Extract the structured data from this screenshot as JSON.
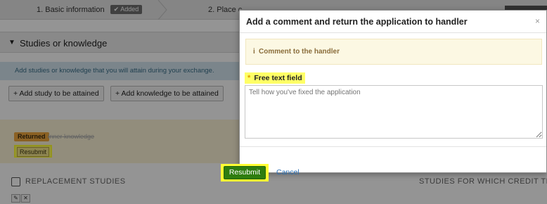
{
  "steps": {
    "step1_label": "1. Basic information",
    "step1_badge": "Added",
    "step2_label": "2. Place c"
  },
  "section": {
    "title": "Studies or knowledge",
    "info": "Add studies or knowledge that you will attain during your exchange.",
    "add_study_label": "Add study to be attained",
    "add_knowledge_label": "Add knowledge to be attained"
  },
  "returned": {
    "badge": "Returned",
    "text": "Inner knowledge",
    "resubmit_label": "Resubmit"
  },
  "replacement": {
    "title": "REPLACEMENT STUDIES",
    "credit_title": "STUDIES FOR WHICH CREDIT TRA"
  },
  "dialog": {
    "title": "Add a comment and return the application to handler",
    "close_symbol": "×",
    "comment_icon": "i",
    "comment_label": "Comment to the handler",
    "required_mark": "*",
    "field_label": "Free text field",
    "textarea_placeholder": "Tell how you've fixed the application",
    "resubmit_label": "Resubmit",
    "cancel_label": "Cancel"
  },
  "colors": {
    "primary_button": "#2e7d0f",
    "highlight": "#ffff33",
    "link": "#2b6fb3",
    "warning_bg": "#fcf8e3"
  }
}
